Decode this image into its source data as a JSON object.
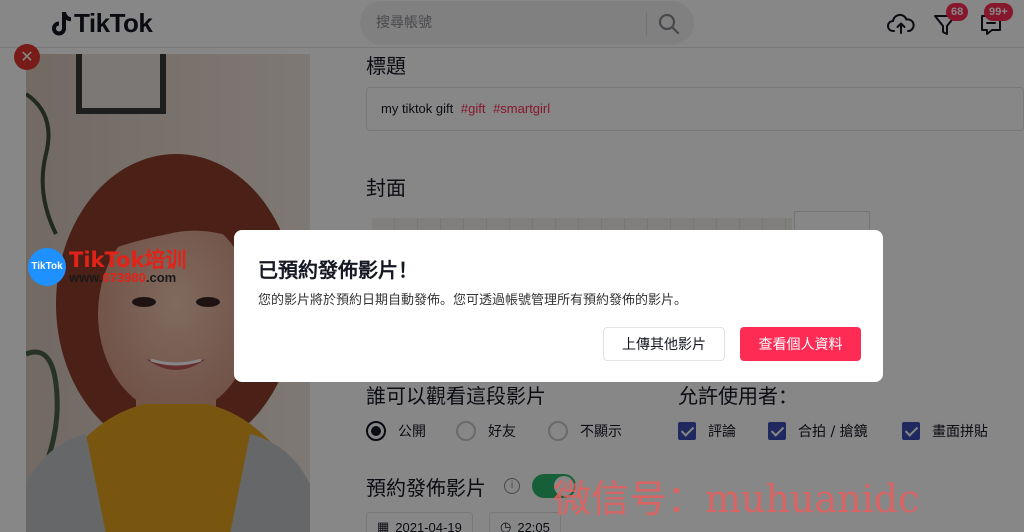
{
  "header": {
    "brand": "TikTok",
    "search_placeholder": "搜尋帳號",
    "inbox_badge": "68",
    "messages_badge": "99+"
  },
  "form": {
    "caption_label": "標題",
    "caption_text": "my tiktok gift",
    "caption_tags": [
      "#gift",
      "#smartgirl"
    ],
    "cover_label": "封面",
    "privacy_label": "誰可以觀看這段影片",
    "privacy_options": [
      "公開",
      "好友",
      "不顯示"
    ],
    "privacy_selected": "公開",
    "allow_label": "允許使用者：",
    "allow_options": [
      "評論",
      "合拍 / 搶鏡",
      "畫面拼貼"
    ],
    "schedule_label": "預約發佈影片",
    "schedule_enabled": true,
    "schedule_date": "2021-04-19",
    "schedule_time": "22:05"
  },
  "modal": {
    "title": "已預約發佈影片！",
    "body": "您的影片將於預約日期自動發佈。您可透過帳號管理所有預約發佈的影片。",
    "secondary_button": "上傳其他影片",
    "primary_button": "查看個人資料"
  },
  "promo": {
    "badge": "TikTok",
    "title": "TikTok培训",
    "url_prefix": "www.",
    "url_highlight": "073980",
    "url_suffix": ".com",
    "watermark": "微信号：muhuanidc"
  },
  "colors": {
    "accent": "#fe2c55",
    "checkbox": "#3b4eb3",
    "toggle_on": "#2cb46b"
  }
}
